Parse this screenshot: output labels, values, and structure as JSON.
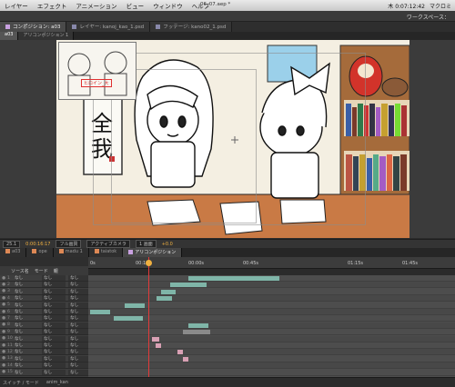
{
  "menubar": {
    "items": [
      "レイヤー",
      "エフェクト",
      "アニメーション",
      "ビュー",
      "ウィンドウ",
      "ヘルプ"
    ],
    "doc_title": "06_07.aep *",
    "clock": "木 0:07:12:42",
    "right_label": "マクロミ"
  },
  "workspace": {
    "label": "ワークスペース："
  },
  "tabs": [
    {
      "label": "コンポジション: a03",
      "active": true,
      "color": "#c8a0e0"
    },
    {
      "label": "レイヤー: kanoj_kao_1.psd",
      "active": false,
      "color": "#88a"
    },
    {
      "label": "フッテージ: kano02_1.psd",
      "active": false,
      "color": "#88a"
    }
  ],
  "subtabs": [
    {
      "label": "a03",
      "active": true
    },
    {
      "label": "アリコンポジション 1",
      "active": false
    }
  ],
  "thumb_label": "ヒロイン_大",
  "ctrlbar": {
    "zoom": "25.1",
    "timecode": "0:00:16:17",
    "quality": "フル画質",
    "view": "アクティブカメラ",
    "views": "1 画面",
    "offset": "+0.0"
  },
  "timeline_tabs": [
    {
      "label": "a03",
      "active": false,
      "color": "#d85"
    },
    {
      "label": "ope",
      "active": false,
      "color": "#d85"
    },
    {
      "label": "madu 1",
      "active": false,
      "color": "#d85"
    },
    {
      "label": "taiatok",
      "active": false,
      "color": "#d85"
    },
    {
      "label": "アリコンポジション",
      "active": true,
      "color": "#c8a0e0"
    }
  ],
  "timeline_header": {
    "col1": "ソース名",
    "col2": "モード",
    "col3": "親"
  },
  "ruler_ticks": [
    "0s",
    "00:15f",
    "00:00s",
    "00:45s",
    "01:15s",
    "01:45s"
  ],
  "layers": [
    {
      "num": "1",
      "name": "なし",
      "mode": "なし",
      "parent": "なし"
    },
    {
      "num": "2",
      "name": "なし",
      "mode": "なし",
      "parent": "なし"
    },
    {
      "num": "3",
      "name": "なし",
      "mode": "なし",
      "parent": "なし"
    },
    {
      "num": "4",
      "name": "なし",
      "mode": "なし",
      "parent": "なし"
    },
    {
      "num": "5",
      "name": "なし",
      "mode": "なし",
      "parent": "なし"
    },
    {
      "num": "6",
      "name": "なし",
      "mode": "なし",
      "parent": "なし"
    },
    {
      "num": "7",
      "name": "なし",
      "mode": "なし",
      "parent": "なし"
    },
    {
      "num": "8",
      "name": "なし",
      "mode": "なし",
      "parent": "なし"
    },
    {
      "num": "9",
      "name": "なし",
      "mode": "なし",
      "parent": "なし"
    },
    {
      "num": "10",
      "name": "なし",
      "mode": "なし",
      "parent": "なし"
    },
    {
      "num": "11",
      "name": "なし",
      "mode": "なし",
      "parent": "なし"
    },
    {
      "num": "12",
      "name": "なし",
      "mode": "なし",
      "parent": "なし"
    },
    {
      "num": "13",
      "name": "なし",
      "mode": "なし",
      "parent": "なし"
    },
    {
      "num": "14",
      "name": "なし",
      "mode": "なし",
      "parent": "なし"
    },
    {
      "num": "15",
      "name": "なし",
      "mode": "なし",
      "parent": "なし"
    }
  ],
  "footer": {
    "left": "スイッチ / モード",
    "mid": "anim_kan"
  },
  "colors": {
    "accent": "#f0b040",
    "playhead": "#e23a3a",
    "bar_teal": "#7fb5a8",
    "bar_pink": "#d8a0b4"
  }
}
